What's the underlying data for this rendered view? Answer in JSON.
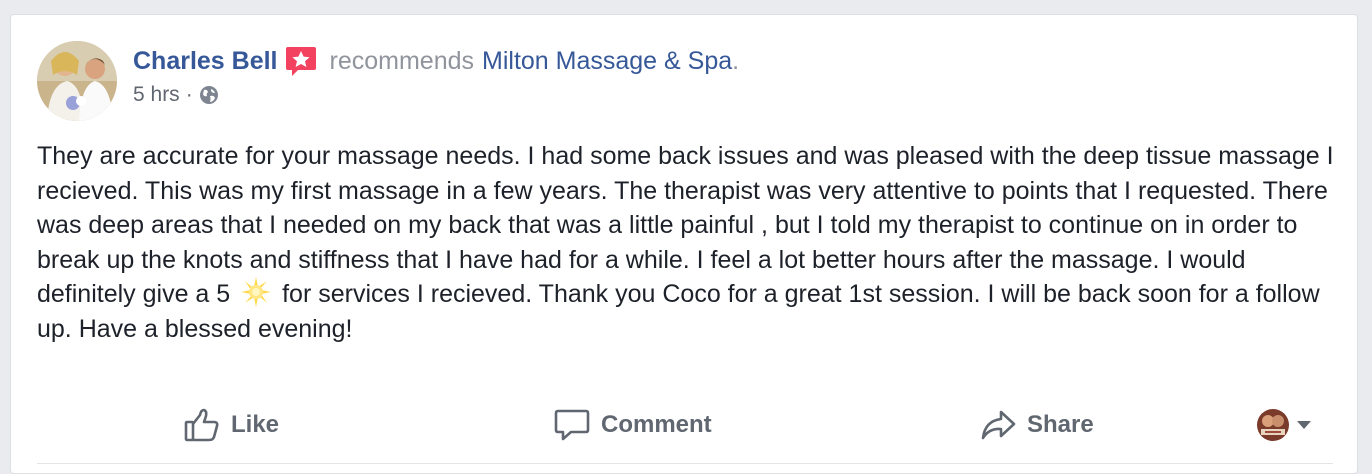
{
  "post": {
    "author": "Charles Bell",
    "verb": "recommends",
    "page": "Milton Massage & Spa",
    "page_suffix": ".",
    "time": "5 hrs",
    "separator": "·",
    "privacy_icon": "globe-icon",
    "badge_icon": "recommendation-badge-icon",
    "body_before_emoji": "They are accurate for your massage needs. I had some back issues and was pleased with the deep tissue massage I recieved. This was my first massage in a few years. The therapist was very attentive to points that I requested. There was deep areas that I needed on my back that was a little painful , but I told my therapist to continue on in order to break up the knots and stiffness that I have had for a while. I feel a lot better hours after the massage. I would definitely give a 5",
    "emoji": "sun-emoji",
    "body_after_emoji": "for services I recieved. Thank you Coco for a great 1st session. I will be back soon for a follow up. Have a blessed evening!"
  },
  "actions": {
    "like_label": "Like",
    "comment_label": "Comment",
    "share_label": "Share",
    "like_icon": "thumbs-up-icon",
    "comment_icon": "speech-bubble-icon",
    "share_icon": "share-arrow-icon"
  },
  "colors": {
    "link": "#365899",
    "text": "#1d2129",
    "muted": "#90949c",
    "action": "#606770",
    "badge": "#f3425f",
    "background": "#e9ebee"
  }
}
